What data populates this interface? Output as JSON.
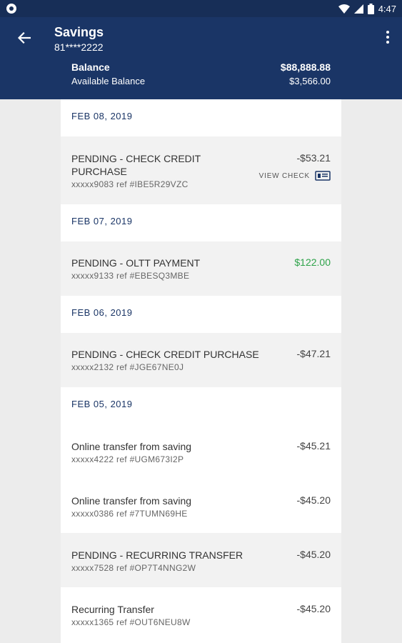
{
  "status_bar": {
    "time": "4:47"
  },
  "header": {
    "title": "Savings",
    "account_number": "81****2222",
    "balance_label": "Balance",
    "balance_value": "$88,888.88",
    "available_label": "Available Balance",
    "available_value": "$3,566.00"
  },
  "groups": [
    {
      "date": "FEB 08, 2019",
      "transactions": [
        {
          "description": "PENDING - CHECK CREDIT PURCHASE",
          "ref": "xxxxx9083 ref #IBE5R29VZC",
          "amount": "-$53.21",
          "action": "VIEW CHECK"
        }
      ]
    },
    {
      "date": "FEB 07, 2019",
      "transactions": [
        {
          "description": "PENDING - OLTT PAYMENT",
          "ref": "xxxxx9133 ref #EBESQ3MBE",
          "amount": "$122.00"
        }
      ]
    },
    {
      "date": "FEB 06, 2019",
      "transactions": [
        {
          "description": "PENDING - CHECK CREDIT PURCHASE",
          "ref": "xxxxx2132 ref #JGE67NE0J",
          "amount": "-$47.21"
        }
      ]
    },
    {
      "date": "FEB 05, 2019",
      "transactions": [
        {
          "description": "Online transfer from saving",
          "ref": "xxxxx4222 ref #UGM673I2P",
          "amount": "-$45.21"
        },
        {
          "description": "Online transfer from saving",
          "ref": "xxxxx0386 ref #7TUMN69HE",
          "amount": "-$45.20"
        },
        {
          "description": "PENDING - RECURRING TRANSFER",
          "ref": "xxxxx7528 ref #OP7T4NNG2W",
          "amount": "-$45.20"
        },
        {
          "description": "Recurring Transfer",
          "ref": "xxxxx1365 ref #OUT6NEU8W",
          "amount": "-$45.20"
        }
      ]
    }
  ],
  "colors": {
    "header_bg": "#1a3566",
    "status_bg": "#172e57",
    "positive_amount": "#2ea34a"
  },
  "icons": [
    "back-arrow-icon",
    "more-vert-icon",
    "check-icon",
    "wifi-icon",
    "battery-icon",
    "notification-icon"
  ]
}
